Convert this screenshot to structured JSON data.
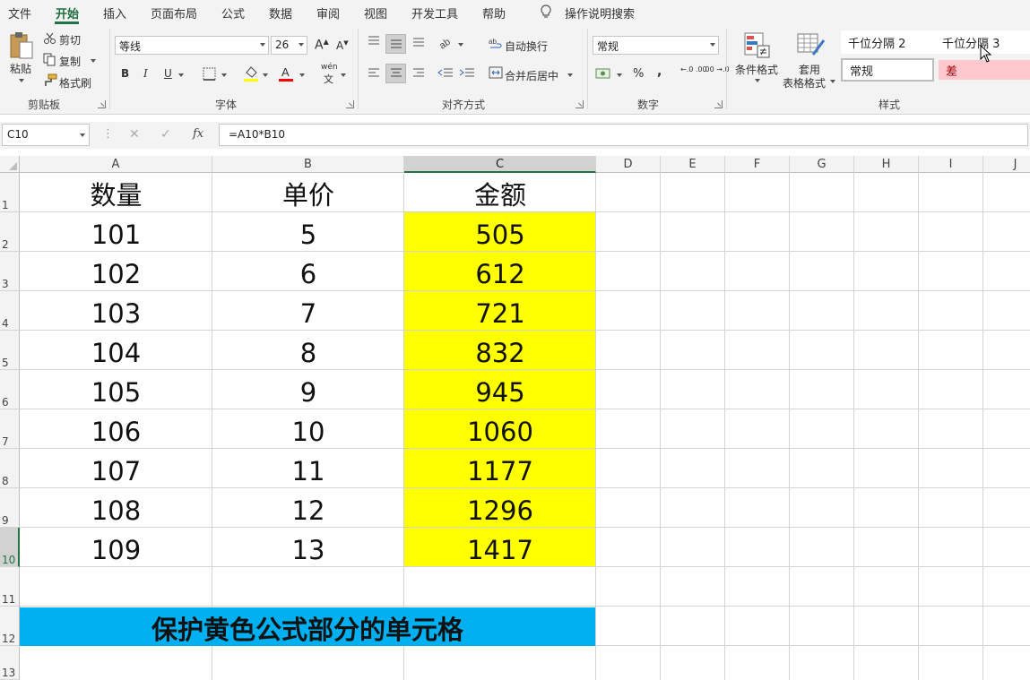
{
  "tabs": [
    "文件",
    "开始",
    "插入",
    "页面布局",
    "公式",
    "数据",
    "审阅",
    "视图",
    "开发工具",
    "帮助"
  ],
  "active_tab": "开始",
  "search": {
    "label": "操作说明搜索"
  },
  "clipboard": {
    "paste": "粘贴",
    "cut": "剪切",
    "copy": "复制",
    "format_painter": "格式刷",
    "group": "剪贴板"
  },
  "font": {
    "name": "等线",
    "size": "26",
    "bold": "B",
    "italic": "I",
    "underline": "U",
    "phonetic": "wén",
    "phonetic_sub": "文",
    "group": "字体",
    "fill_color": "#ffff00",
    "font_color": "#ff0000"
  },
  "alignment": {
    "wrap_text": "自动换行",
    "merge_center": "合并后居中",
    "group": "对齐方式"
  },
  "number": {
    "format": "常规",
    "percent": "%",
    "comma": ",",
    "inc_decimal": "←.0 .00",
    "dec_decimal": ".00 →.0",
    "group": "数字"
  },
  "styles": {
    "conditional": "条件格式",
    "table_format_1": "套用",
    "table_format_2": "表格格式",
    "cells": [
      "千位分隔 2",
      "千位分隔 3",
      "常规",
      "差"
    ],
    "group": "样式",
    "bad_color": "#ffc7ce"
  },
  "formula_bar": {
    "name_box": "C10",
    "cancel": "✕",
    "enter": "✓",
    "fx": "fx",
    "formula": "=A10*B10"
  },
  "columns": [
    "A",
    "B",
    "C",
    "D",
    "E",
    "F",
    "G",
    "H",
    "I",
    "J"
  ],
  "selected_column": "C",
  "rows": [
    "1",
    "2",
    "3",
    "4",
    "5",
    "6",
    "7",
    "8",
    "9",
    "10",
    "11",
    "12",
    "13"
  ],
  "selected_row": "10",
  "sheet": {
    "headers": [
      "数量",
      "单价",
      "金额"
    ],
    "data": [
      [
        "101",
        "5",
        "505"
      ],
      [
        "102",
        "6",
        "612"
      ],
      [
        "103",
        "7",
        "721"
      ],
      [
        "104",
        "8",
        "832"
      ],
      [
        "105",
        "9",
        "945"
      ],
      [
        "106",
        "10",
        "1060"
      ],
      [
        "107",
        "11",
        "1177"
      ],
      [
        "108",
        "12",
        "1296"
      ],
      [
        "109",
        "13",
        "1417"
      ]
    ],
    "banner": "保护黄色公式部分的单元格",
    "highlight_color": "#ffff00",
    "banner_color": "#00b0f0"
  }
}
